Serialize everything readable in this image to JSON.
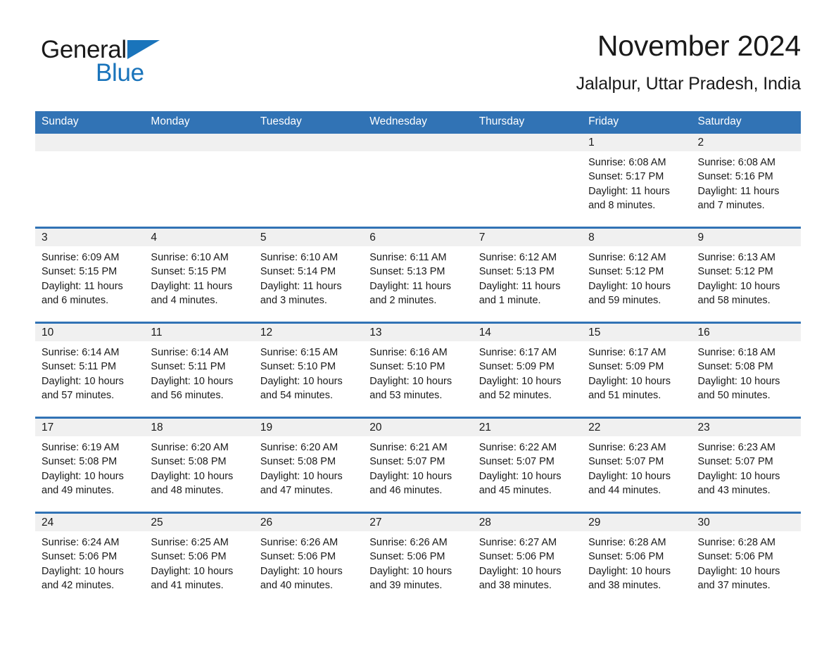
{
  "logo": {
    "word1": "General",
    "word2": "Blue",
    "triangle_color": "#1a74bb",
    "icon": "triangle-icon"
  },
  "header": {
    "title": "November 2024",
    "subtitle": "Jalalpur, Uttar Pradesh, India"
  },
  "colors": {
    "header_blue": "#3173b5",
    "daynum_band": "#f0f0f0",
    "text": "#1a1a1a",
    "logo_blue": "#1a74bb"
  },
  "weekdays": [
    "Sunday",
    "Monday",
    "Tuesday",
    "Wednesday",
    "Thursday",
    "Friday",
    "Saturday"
  ],
  "labels": {
    "sunrise_prefix": "Sunrise:",
    "sunset_prefix": "Sunset:",
    "daylight_prefix": "Daylight:"
  },
  "weeks": [
    [
      {
        "day": "",
        "line1": "",
        "line2": "",
        "line3": "",
        "line4": ""
      },
      {
        "day": "",
        "line1": "",
        "line2": "",
        "line3": "",
        "line4": ""
      },
      {
        "day": "",
        "line1": "",
        "line2": "",
        "line3": "",
        "line4": ""
      },
      {
        "day": "",
        "line1": "",
        "line2": "",
        "line3": "",
        "line4": ""
      },
      {
        "day": "",
        "line1": "",
        "line2": "",
        "line3": "",
        "line4": ""
      },
      {
        "day": "1",
        "line1": "Sunrise: 6:08 AM",
        "line2": "Sunset: 5:17 PM",
        "line3": "Daylight: 11 hours",
        "line4": "and 8 minutes."
      },
      {
        "day": "2",
        "line1": "Sunrise: 6:08 AM",
        "line2": "Sunset: 5:16 PM",
        "line3": "Daylight: 11 hours",
        "line4": "and 7 minutes."
      }
    ],
    [
      {
        "day": "3",
        "line1": "Sunrise: 6:09 AM",
        "line2": "Sunset: 5:15 PM",
        "line3": "Daylight: 11 hours",
        "line4": "and 6 minutes."
      },
      {
        "day": "4",
        "line1": "Sunrise: 6:10 AM",
        "line2": "Sunset: 5:15 PM",
        "line3": "Daylight: 11 hours",
        "line4": "and 4 minutes."
      },
      {
        "day": "5",
        "line1": "Sunrise: 6:10 AM",
        "line2": "Sunset: 5:14 PM",
        "line3": "Daylight: 11 hours",
        "line4": "and 3 minutes."
      },
      {
        "day": "6",
        "line1": "Sunrise: 6:11 AM",
        "line2": "Sunset: 5:13 PM",
        "line3": "Daylight: 11 hours",
        "line4": "and 2 minutes."
      },
      {
        "day": "7",
        "line1": "Sunrise: 6:12 AM",
        "line2": "Sunset: 5:13 PM",
        "line3": "Daylight: 11 hours",
        "line4": "and 1 minute."
      },
      {
        "day": "8",
        "line1": "Sunrise: 6:12 AM",
        "line2": "Sunset: 5:12 PM",
        "line3": "Daylight: 10 hours",
        "line4": "and 59 minutes."
      },
      {
        "day": "9",
        "line1": "Sunrise: 6:13 AM",
        "line2": "Sunset: 5:12 PM",
        "line3": "Daylight: 10 hours",
        "line4": "and 58 minutes."
      }
    ],
    [
      {
        "day": "10",
        "line1": "Sunrise: 6:14 AM",
        "line2": "Sunset: 5:11 PM",
        "line3": "Daylight: 10 hours",
        "line4": "and 57 minutes."
      },
      {
        "day": "11",
        "line1": "Sunrise: 6:14 AM",
        "line2": "Sunset: 5:11 PM",
        "line3": "Daylight: 10 hours",
        "line4": "and 56 minutes."
      },
      {
        "day": "12",
        "line1": "Sunrise: 6:15 AM",
        "line2": "Sunset: 5:10 PM",
        "line3": "Daylight: 10 hours",
        "line4": "and 54 minutes."
      },
      {
        "day": "13",
        "line1": "Sunrise: 6:16 AM",
        "line2": "Sunset: 5:10 PM",
        "line3": "Daylight: 10 hours",
        "line4": "and 53 minutes."
      },
      {
        "day": "14",
        "line1": "Sunrise: 6:17 AM",
        "line2": "Sunset: 5:09 PM",
        "line3": "Daylight: 10 hours",
        "line4": "and 52 minutes."
      },
      {
        "day": "15",
        "line1": "Sunrise: 6:17 AM",
        "line2": "Sunset: 5:09 PM",
        "line3": "Daylight: 10 hours",
        "line4": "and 51 minutes."
      },
      {
        "day": "16",
        "line1": "Sunrise: 6:18 AM",
        "line2": "Sunset: 5:08 PM",
        "line3": "Daylight: 10 hours",
        "line4": "and 50 minutes."
      }
    ],
    [
      {
        "day": "17",
        "line1": "Sunrise: 6:19 AM",
        "line2": "Sunset: 5:08 PM",
        "line3": "Daylight: 10 hours",
        "line4": "and 49 minutes."
      },
      {
        "day": "18",
        "line1": "Sunrise: 6:20 AM",
        "line2": "Sunset: 5:08 PM",
        "line3": "Daylight: 10 hours",
        "line4": "and 48 minutes."
      },
      {
        "day": "19",
        "line1": "Sunrise: 6:20 AM",
        "line2": "Sunset: 5:08 PM",
        "line3": "Daylight: 10 hours",
        "line4": "and 47 minutes."
      },
      {
        "day": "20",
        "line1": "Sunrise: 6:21 AM",
        "line2": "Sunset: 5:07 PM",
        "line3": "Daylight: 10 hours",
        "line4": "and 46 minutes."
      },
      {
        "day": "21",
        "line1": "Sunrise: 6:22 AM",
        "line2": "Sunset: 5:07 PM",
        "line3": "Daylight: 10 hours",
        "line4": "and 45 minutes."
      },
      {
        "day": "22",
        "line1": "Sunrise: 6:23 AM",
        "line2": "Sunset: 5:07 PM",
        "line3": "Daylight: 10 hours",
        "line4": "and 44 minutes."
      },
      {
        "day": "23",
        "line1": "Sunrise: 6:23 AM",
        "line2": "Sunset: 5:07 PM",
        "line3": "Daylight: 10 hours",
        "line4": "and 43 minutes."
      }
    ],
    [
      {
        "day": "24",
        "line1": "Sunrise: 6:24 AM",
        "line2": "Sunset: 5:06 PM",
        "line3": "Daylight: 10 hours",
        "line4": "and 42 minutes."
      },
      {
        "day": "25",
        "line1": "Sunrise: 6:25 AM",
        "line2": "Sunset: 5:06 PM",
        "line3": "Daylight: 10 hours",
        "line4": "and 41 minutes."
      },
      {
        "day": "26",
        "line1": "Sunrise: 6:26 AM",
        "line2": "Sunset: 5:06 PM",
        "line3": "Daylight: 10 hours",
        "line4": "and 40 minutes."
      },
      {
        "day": "27",
        "line1": "Sunrise: 6:26 AM",
        "line2": "Sunset: 5:06 PM",
        "line3": "Daylight: 10 hours",
        "line4": "and 39 minutes."
      },
      {
        "day": "28",
        "line1": "Sunrise: 6:27 AM",
        "line2": "Sunset: 5:06 PM",
        "line3": "Daylight: 10 hours",
        "line4": "and 38 minutes."
      },
      {
        "day": "29",
        "line1": "Sunrise: 6:28 AM",
        "line2": "Sunset: 5:06 PM",
        "line3": "Daylight: 10 hours",
        "line4": "and 38 minutes."
      },
      {
        "day": "30",
        "line1": "Sunrise: 6:28 AM",
        "line2": "Sunset: 5:06 PM",
        "line3": "Daylight: 10 hours",
        "line4": "and 37 minutes."
      }
    ]
  ]
}
